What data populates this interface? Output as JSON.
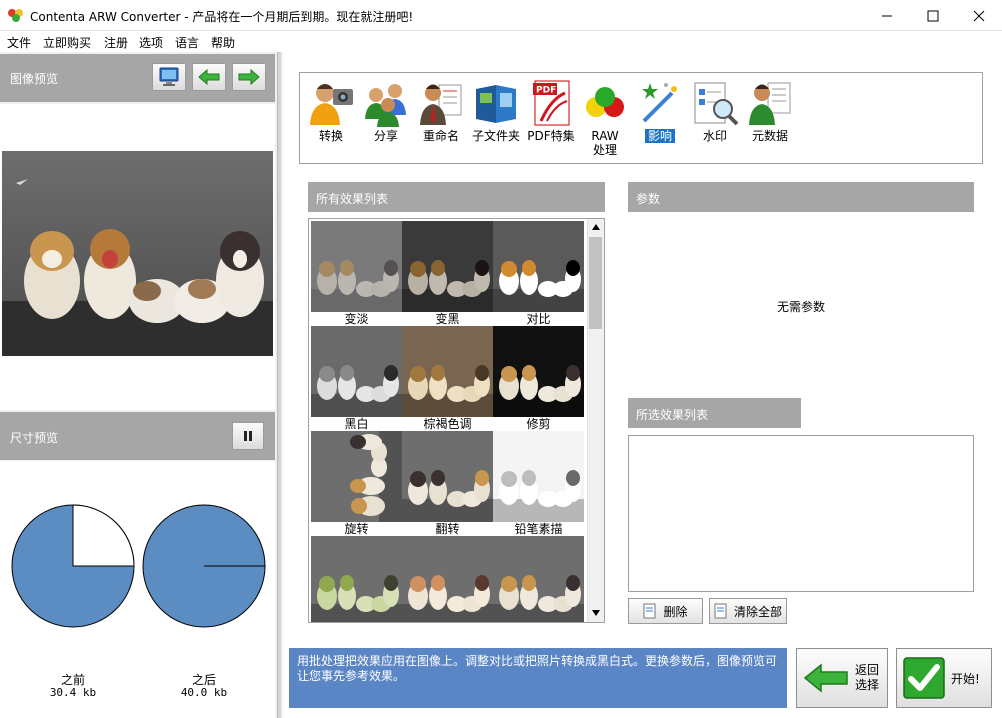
{
  "window": {
    "title": "Contenta ARW Converter  - 产品将在一个月期后到期。现在就注册吧!",
    "minimize_icon": "minimize-icon",
    "maximize_icon": "maximize-icon",
    "close_icon": "close-icon"
  },
  "menu": [
    "文件",
    "立即购买",
    "注册",
    "选项",
    "语言",
    "帮助"
  ],
  "image_preview": {
    "title": "图像预览",
    "buttons": [
      "monitor-icon",
      "arrow-left-icon",
      "arrow-right-icon"
    ]
  },
  "size_preview": {
    "title": "尺寸预览",
    "pause_icon": "pause-icon",
    "before_label": "之前",
    "before_size": "30.4 kb",
    "after_label": "之后",
    "after_size": "40.0 kb",
    "before_fraction": 0.25,
    "after_fraction": 0.0
  },
  "toolbar": [
    {
      "label": "转换",
      "icon": "convert-person-camera-icon"
    },
    {
      "label": "分享",
      "icon": "share-people-icon"
    },
    {
      "label": "重命名",
      "icon": "rename-person-icon"
    },
    {
      "label": "子文件夹",
      "icon": "subfolder-book-icon"
    },
    {
      "label": "PDF特集",
      "icon": "pdf-icon"
    },
    {
      "label": "RAW\n处理",
      "icon": "raw-balls-icon"
    },
    {
      "label": "影响",
      "icon": "effects-wand-icon",
      "selected": true
    },
    {
      "label": "水印",
      "icon": "watermark-magnifier-icon"
    },
    {
      "label": "元数据",
      "icon": "metadata-person-icon"
    }
  ],
  "effects": {
    "title": "所有效果列表",
    "items": [
      "变淡",
      "变黑",
      "对比",
      "黑白",
      "棕褐色调",
      "修剪",
      "旋转",
      "翻转",
      "铅笔素描",
      "",
      "",
      ""
    ]
  },
  "params": {
    "title": "参数",
    "message": "无需参数"
  },
  "selected_effects": {
    "title": "所选效果列表",
    "delete_label": "删除",
    "clear_label": "清除全部"
  },
  "help_text": "用批处理把效果应用在图像上。调整对比或把照片转换成黑白式。更换参数后，图像预览可让您事先参考效果。",
  "back_button": {
    "line1": "返回",
    "line2": "选择",
    "icon": "arrow-back-icon"
  },
  "start_button": {
    "label": "开始!",
    "icon": "checkmark-icon"
  },
  "colors": {
    "header_gray": "#a6a6a6",
    "pie_blue": "#5b8cc2",
    "help_blue": "#5b86c6",
    "selection_blue": "#1e72c8"
  }
}
